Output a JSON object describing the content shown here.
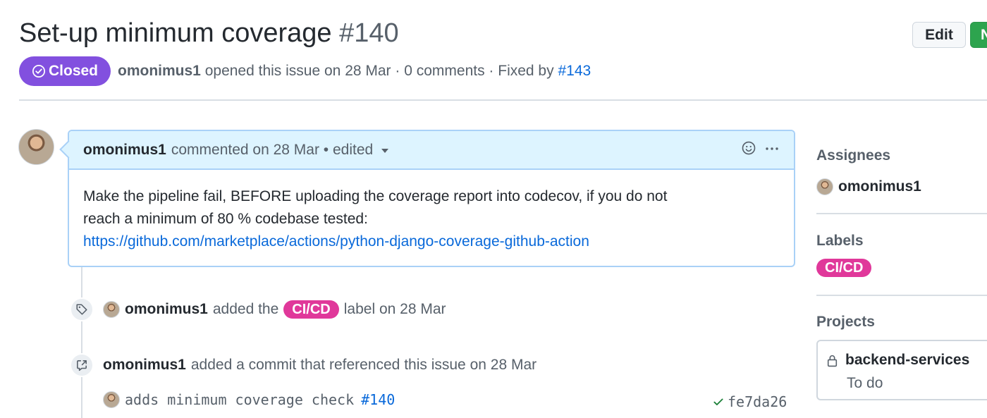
{
  "issue": {
    "title": "Set-up minimum coverage",
    "number": "#140",
    "state": "Closed",
    "author": "omonimus1",
    "opened_text": "opened this issue on 28 Mar · 0 comments · Fixed by",
    "fixed_by": "#143"
  },
  "header_actions": {
    "edit_label": "Edit",
    "new_label": "N"
  },
  "comment": {
    "author": "omonimus1",
    "meta": "commented on 28 Mar • edited",
    "body_line1": "Make the pipeline fail, BEFORE uploading the coverage report into codecov, if you do not",
    "body_line2": "reach a minimum of 80 % codebase tested:",
    "link": "https://github.com/marketplace/actions/python-django-coverage-github-action"
  },
  "timeline": {
    "label_event": {
      "author": "omonimus1",
      "before": "added the",
      "label": "CI/CD",
      "after": "label on 28 Mar"
    },
    "commit_event": {
      "author": "omonimus1",
      "text": "added a commit that referenced this issue on 28 Mar",
      "commit_message": "adds minimum coverage check",
      "commit_ref": "#140",
      "sha": "fe7da26"
    }
  },
  "sidebar": {
    "assignees_heading": "Assignees",
    "assignee": "omonimus1",
    "labels_heading": "Labels",
    "label": "CI/CD",
    "projects_heading": "Projects",
    "project_name": "backend-services",
    "project_column": "To do"
  },
  "colors": {
    "closed_badge": "#8250df",
    "label_cicd": "#e0389a",
    "link": "#0969da",
    "comment_header_bg": "#ddf4ff"
  },
  "icons": [
    "check-circle-icon",
    "smiley-icon",
    "kebab-horizontal-icon",
    "tag-icon",
    "cross-reference-icon",
    "check-icon",
    "lock-icon"
  ]
}
